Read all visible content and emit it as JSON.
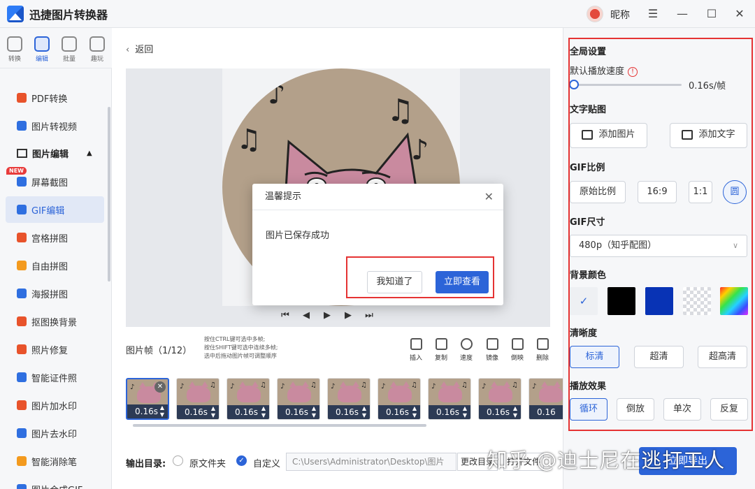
{
  "app": {
    "title": "迅捷图片转换器",
    "nickname": "昵称"
  },
  "rail": [
    {
      "label": "转换"
    },
    {
      "label": "编辑"
    },
    {
      "label": "批量"
    },
    {
      "label": "趣玩"
    }
  ],
  "sidebar": {
    "items": [
      {
        "label": "PDF转换",
        "color": "#e8532b"
      },
      {
        "label": "图片转视频",
        "color": "#2f6fe0"
      },
      {
        "label": "屏幕截图",
        "color": "#2f6fe0"
      },
      {
        "label": "GIF编辑",
        "color": "#2f6fe0"
      },
      {
        "label": "宫格拼图",
        "color": "#e8532b"
      },
      {
        "label": "自由拼图",
        "color": "#f39a1e"
      },
      {
        "label": "海报拼图",
        "color": "#2f6fe0"
      },
      {
        "label": "抠图换背景",
        "color": "#e8532b"
      },
      {
        "label": "照片修复",
        "color": "#e8532b"
      },
      {
        "label": "智能证件照",
        "color": "#2f6fe0"
      },
      {
        "label": "图片加水印",
        "color": "#e8532b"
      },
      {
        "label": "图片去水印",
        "color": "#2f6fe0"
      },
      {
        "label": "智能消除笔",
        "color": "#f39a1e"
      },
      {
        "label": "图片合成GIF",
        "color": "#2f6fe0"
      }
    ],
    "group_label": "图片编辑",
    "new_badge": "NEW"
  },
  "main": {
    "back_label": "返回",
    "frames_label": "图片帧（1/12）",
    "hints": [
      "按住CTRL键可选中多帧;",
      "按住SHIFT键可选中连续多帧;",
      "选中后拖动图片帧可调整顺序"
    ],
    "tools": [
      {
        "label": "插入"
      },
      {
        "label": "复制"
      },
      {
        "label": "速度"
      },
      {
        "label": "镜像"
      },
      {
        "label": "倒映"
      },
      {
        "label": "删除"
      }
    ],
    "frames": [
      "0.16s",
      "0.16s",
      "0.16s",
      "0.16s",
      "0.16s",
      "0.16s",
      "0.16s",
      "0.16s",
      "0.16"
    ],
    "output": {
      "label": "输出目录:",
      "option_original": "原文件夹",
      "option_custom": "自定义",
      "path": "C:\\Users\\Administrator\\Desktop\\图片",
      "change_dir": "更改目录",
      "open_dir": "打开文件"
    }
  },
  "panel": {
    "global_title": "全局设置",
    "speed_label": "默认播放速度",
    "speed_value": "0.16s/帧",
    "sticker_title": "文字贴图",
    "add_image": "添加图片",
    "add_text": "添加文字",
    "ratio_title": "GIF比例",
    "ratios": [
      "原始比例",
      "16:9",
      "1:1",
      "圆"
    ],
    "size_title": "GIF尺寸",
    "size_value": "480p（知乎配图）",
    "bg_title": "背景颜色",
    "bg_colors": [
      "none",
      "#000000",
      "#0833b5",
      "transparent",
      "rainbow"
    ],
    "clarity_title": "清晰度",
    "clarity": [
      "标清",
      "超清",
      "超高清"
    ],
    "effect_title": "播放效果",
    "effects": [
      "循环",
      "倒放",
      "单次",
      "反复"
    ],
    "export_label": "立即导出"
  },
  "dialog": {
    "title": "温馨提示",
    "message": "图片已保存成功",
    "dismiss": "我知道了",
    "view": "立即查看"
  },
  "watermark": "知乎 @迪士尼在逃打工人"
}
